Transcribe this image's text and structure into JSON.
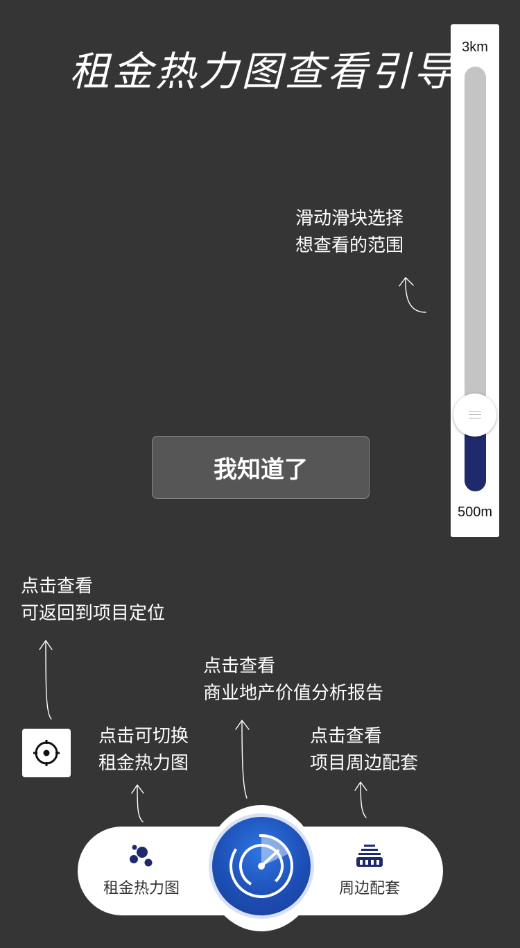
{
  "title": "租金热力图查看引导",
  "slider": {
    "max_label": "3km",
    "min_label": "500m",
    "level": 0.18
  },
  "hints": {
    "slider": [
      "滑动滑块选择",
      "想查看的范围"
    ],
    "locate": [
      "点击查看",
      "可返回到项目定位"
    ],
    "report": [
      "点击查看",
      "商业地产价值分析报告"
    ],
    "heatmap": [
      "点击可切换",
      "租金热力图"
    ],
    "surroundings": [
      "点击查看",
      "项目周边配套"
    ]
  },
  "confirm_label": "我知道了",
  "bottom_bar": {
    "heatmap_label": "租金热力图",
    "surroundings_label": "周边配套"
  },
  "icons": [
    "target-icon",
    "bubbles-icon",
    "radar-icon",
    "building-icon"
  ],
  "colors": {
    "background": "#353535",
    "accent": "#1d4fb6",
    "navy": "#1e2a6b"
  }
}
